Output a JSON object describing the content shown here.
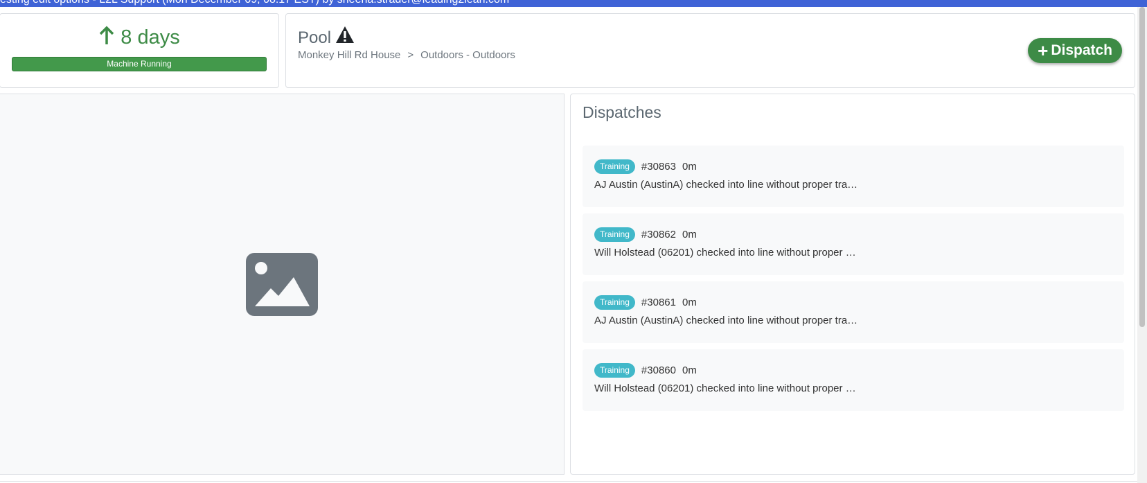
{
  "topbar": {
    "text": "esting edit options - L2L Support (Mon December 09, 08:17 EST) by sheena.strader@leading2lean.com"
  },
  "status": {
    "uptime_value": "8 days",
    "uptime_icon": "arrow-up-icon",
    "running_label": "Machine Running"
  },
  "header": {
    "asset_name": "Pool",
    "alert_icon": "warning-triangle-icon",
    "breadcrumb": [
      "Monkey Hill Rd House",
      ">",
      "Outdoors - Outdoors"
    ],
    "dispatch_button": "Dispatch"
  },
  "image_panel": {
    "icon": "image-placeholder-icon"
  },
  "dispatches": {
    "title": "Dispatches",
    "items": [
      {
        "badge": "Training",
        "id": "#30863",
        "age": "0m",
        "text": "AJ Austin (AustinA) checked into line without proper tra…"
      },
      {
        "badge": "Training",
        "id": "#30862",
        "age": "0m",
        "text": "Will Holstead (06201) checked into line without proper …"
      },
      {
        "badge": "Training",
        "id": "#30861",
        "age": "0m",
        "text": "AJ Austin (AustinA) checked into line without proper tra…"
      },
      {
        "badge": "Training",
        "id": "#30860",
        "age": "0m",
        "text": "Will Holstead (06201) checked into line without proper …"
      }
    ]
  },
  "colors": {
    "accent_green": "#3d8b46",
    "badge_teal": "#41b8c9",
    "topbar_blue": "#3f63d6"
  }
}
